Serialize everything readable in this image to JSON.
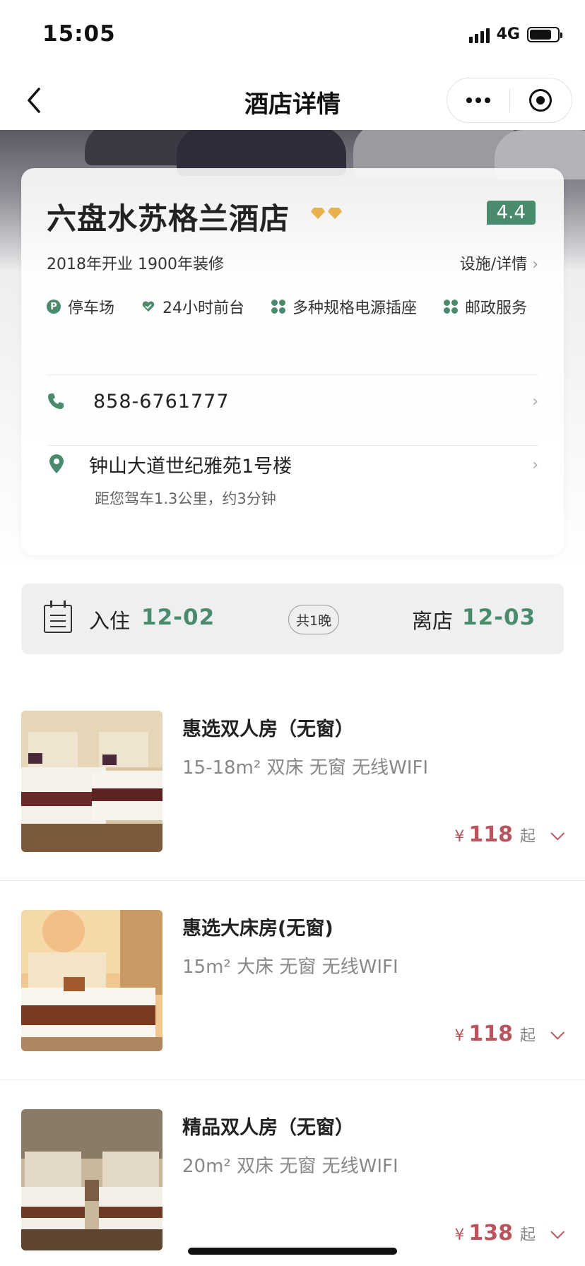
{
  "status_bar": {
    "time": "15:05",
    "network": "4G",
    "battery_level": 0.8
  },
  "nav": {
    "title": "酒店详情",
    "back_icon": "chevron-left-icon",
    "more_icon": "more-dots-icon",
    "close_icon": "target-icon"
  },
  "hotel": {
    "name": "六盘水苏格兰酒店",
    "rating": "4.4",
    "diamond_count": 2,
    "opened": "2018年开业 1900年装修",
    "facility_link": "设施/详情",
    "amenities": [
      {
        "label": "停车场",
        "icon": "parking-icon"
      },
      {
        "label": "24小时前台",
        "icon": "heart-icon"
      },
      {
        "label": "多种规格电源插座",
        "icon": "clover-icon"
      },
      {
        "label": "邮政服务",
        "icon": "clover-icon"
      }
    ],
    "phone": "858-6761777",
    "address": "钟山大道世纪雅苑1号楼",
    "distance": "距您驾车1.3公里，约3分钟"
  },
  "stay": {
    "checkin_label": "入住",
    "checkin_date": "12-02",
    "nights": "共1晚",
    "checkout_label": "离店",
    "checkout_date": "12-03"
  },
  "rooms": [
    {
      "name": "惠选双人房（无窗）",
      "desc": "15-18m² 双床 无窗 无线WIFI",
      "currency": "¥",
      "price": "118",
      "suffix": "起"
    },
    {
      "name": "惠选大床房(无窗)",
      "desc": "15m² 大床 无窗 无线WIFI",
      "currency": "¥",
      "price": "118",
      "suffix": "起"
    },
    {
      "name": "精品双人房（无窗）",
      "desc": "20m² 双床 无窗 无线WIFI",
      "currency": "¥",
      "price": "138",
      "suffix": "起"
    }
  ],
  "colors": {
    "accent_green": "#4a8a6d",
    "price_red": "#b9555f",
    "diamond_gold": "#e9b14b"
  }
}
